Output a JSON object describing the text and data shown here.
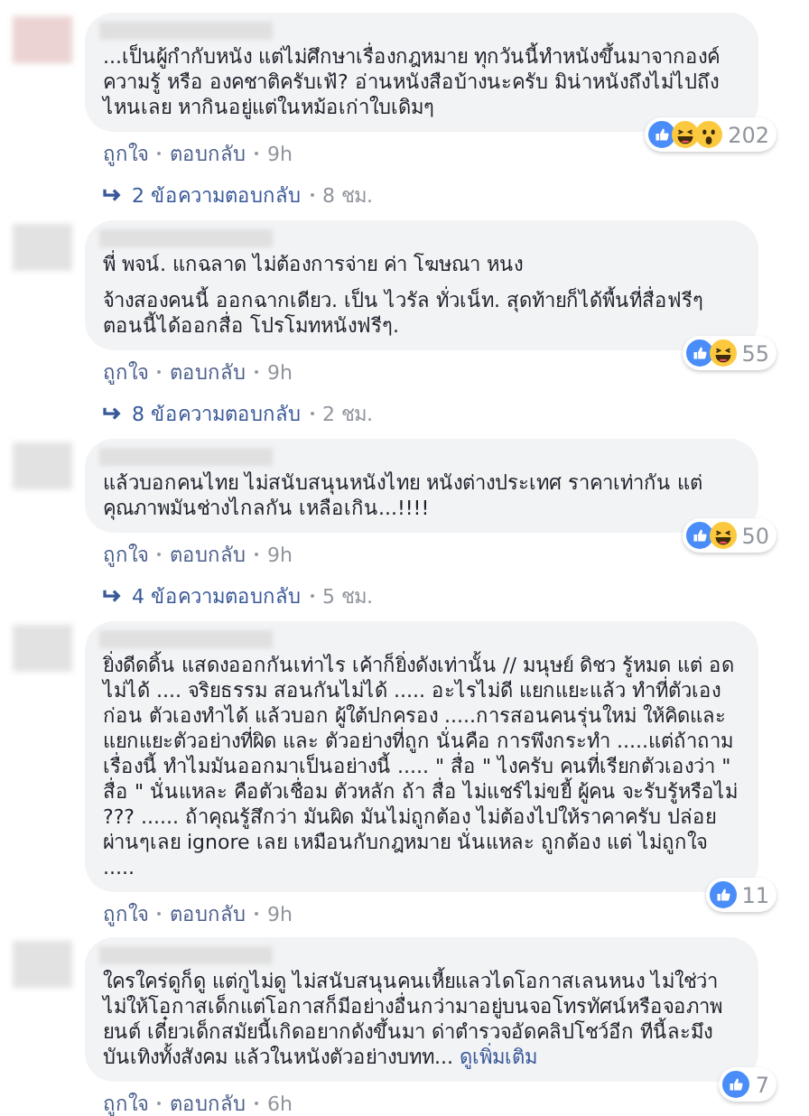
{
  "comments": [
    {
      "paragraphs": [
        "...เป็นผู้กำกับหนัง แต่ไม่ศึกษาเรื่องกฎหมาย ทุกวันนี้ทำหนังขึ้นมาจากองค์ความรู้ หรือ องคชาติครับเฟ้? อ่านหนังสือบ้างนะครับ มิน่าหนังถึงไม่ไปถึงไหนเลย หากินอยู่แต่ในหม้อเก่าใบเดิมๆ"
      ],
      "like_label": "ถูกใจ",
      "reply_label": "ตอบกลับ",
      "time": "9h",
      "reactions": [
        {
          "kind": "like"
        },
        {
          "kind": "haha"
        },
        {
          "kind": "wow"
        }
      ],
      "reaction_count": "202",
      "replies": {
        "count_text": "2 ข้อความตอบกลับ",
        "time": "8 ชม."
      }
    },
    {
      "paragraphs": [
        "พี่ พจน์. แกฉลาด ไม่ต้องการจ่าย ค่า โฆษณา หนง",
        "จ้างสองคนนี้ ออกฉากเดียว. เป็น ไวรัล ทั่วเน็ท. สุดท้ายก็ได้พื้นที่สื่อฟรีๆ ตอนนี้ได้ออกสื่อ โปรโมทหนังฟรีๆ."
      ],
      "like_label": "ถูกใจ",
      "reply_label": "ตอบกลับ",
      "time": "9h",
      "reactions": [
        {
          "kind": "like"
        },
        {
          "kind": "haha"
        }
      ],
      "reaction_count": "55",
      "replies": {
        "count_text": "8 ข้อความตอบกลับ",
        "time": "2 ชม."
      }
    },
    {
      "paragraphs": [
        "แล้วบอกคนไทย ไม่สนับสนุนหนังไทย หนังต่างประเทศ ราคาเท่ากัน แต่ คุณภาพมันช่างไกลกัน เหลือเกิน...!!!!"
      ],
      "like_label": "ถูกใจ",
      "reply_label": "ตอบกลับ",
      "time": "9h",
      "reactions": [
        {
          "kind": "like"
        },
        {
          "kind": "haha"
        }
      ],
      "reaction_count": "50",
      "replies": {
        "count_text": "4 ข้อความตอบกลับ",
        "time": "5 ชม."
      }
    },
    {
      "paragraphs": [
        "ยิ่งดีดดิ้น แสดงออกกันเท่าไร เค้าก็ยิ่งดังเท่านั้น // มนุษย์ ดิชว รู้หมด แต่ อดไม่ได้ .... จริยธรรม สอนกันไม่ได้ ..... อะไรไม่ดี แยกแยะแล้ว ทำที่ตัวเองก่อน ตัวเองทำได้ แล้วบอก ผู้ใต้ปกครอง .....การสอนคนรุ่นใหม่ ให้คิดและแยกแยะตัวอย่างที่ผิด และ ตัวอย่างที่ถูก นั่นคือ การพึงกระทำ .....แต่ถ้าถามเรื่องนี้ ทำไมมันออกมาเป็นอย่างนี้ ..... \" สื่อ \" ไงครับ คนที่เรียกตัวเองว่า \" สื่อ \" นั่นแหละ คือตัวเชื่อม ตัวหลัก ถ้า สื่อ ไม่แชร์ไม่ขยี้ ผู้คน จะรับรู้หรือไม่ ??? ...... ถ้าคุณรู้สึกว่า มันผิด มันไม่ถูกต้อง ไม่ต้องไปให้ราคาครับ ปล่อยผ่านๆเลย ignore เลย เหมือนกับกฎหมาย นั่นแหละ ถูกต้อง แต่ ไม่ถูกใจ ....."
      ],
      "like_label": "ถูกใจ",
      "reply_label": "ตอบกลับ",
      "time": "9h",
      "reactions": [
        {
          "kind": "like"
        }
      ],
      "reaction_count": "11"
    },
    {
      "paragraphs": [
        "ใครใคร่ดูก็ดู แต่กูไม่ดู ไม่สนับสนุนคนเหี้ยแลวไดโอกาสเลนหนง ไม่ใช่ว่าไม่ให้โอกาสเด็กแต่โอกาสก็มีอย่างอื่นกว่ามาอยู่บนจอโทรทัศน์หรือจอภาพยนต์ เดี๋ยวเด็กสมัยนี้เกิดอยากดังขึ้นมา ด่าตำรวจอัดคลิปโชว์อีก ทีนี้ละมึงบันเทิงทั้งสังคม แล้วในหนังตัวอย่างบทท..."
      ],
      "see_more": "ดูเพิ่มเติม",
      "like_label": "ถูกใจ",
      "reply_label": "ตอบกลับ",
      "time": "6h",
      "reactions": [
        {
          "kind": "like"
        }
      ],
      "reaction_count": "7"
    }
  ]
}
